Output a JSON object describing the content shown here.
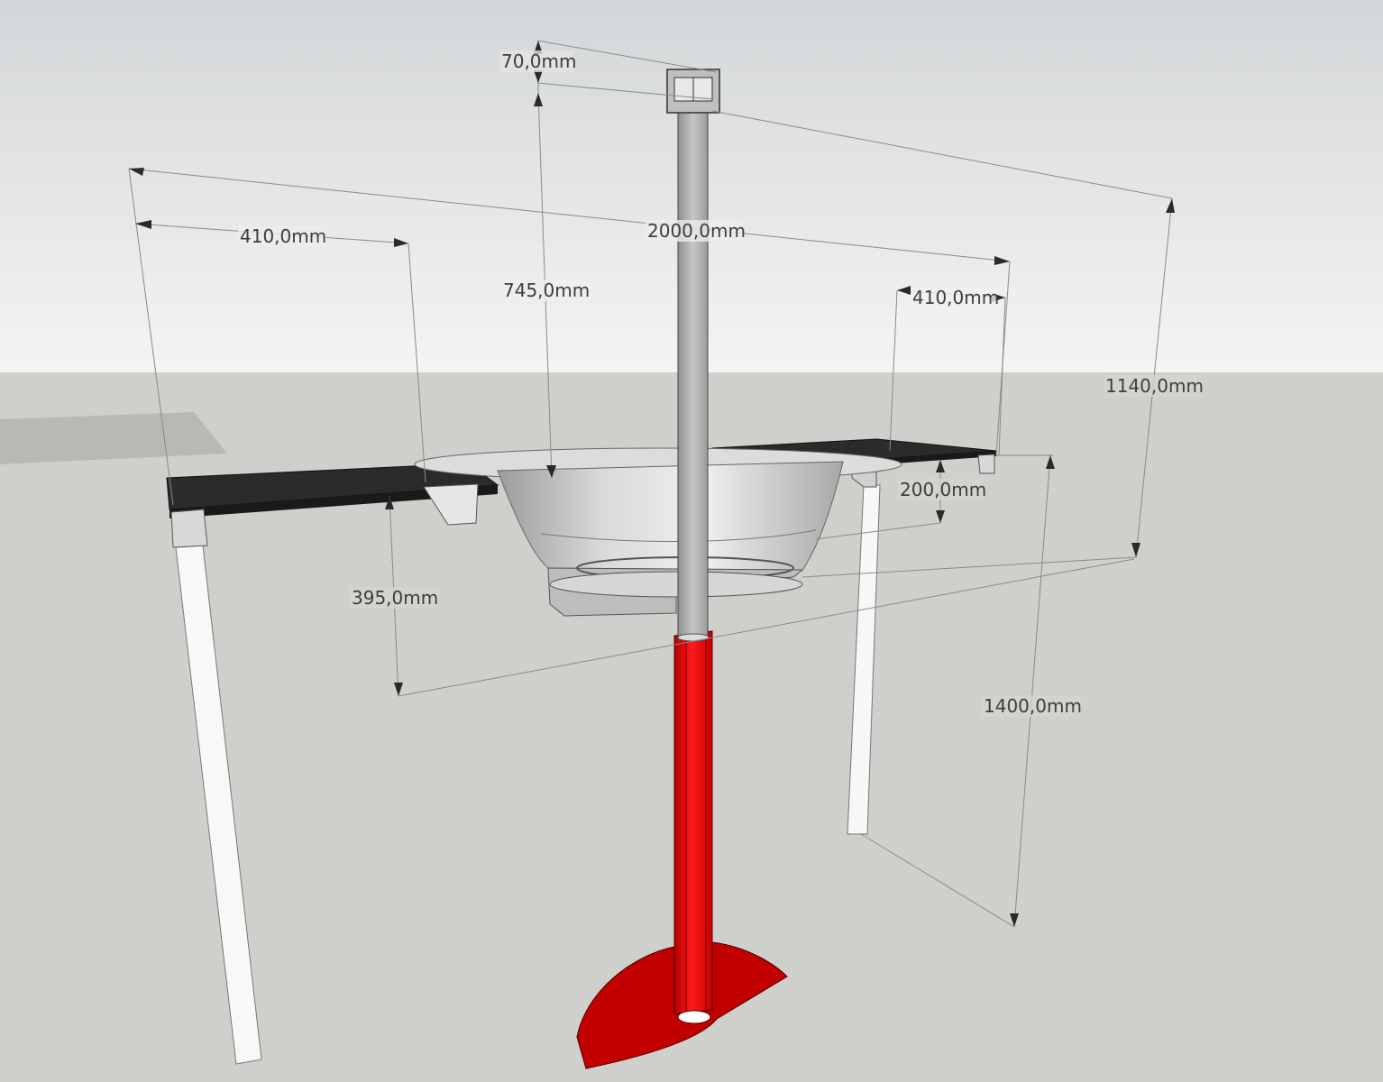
{
  "colors": {
    "sky_top": "#d6d9db",
    "sky_bottom": "#f2f2f2",
    "ground": "#cfcfcc",
    "tabletop": "#2e2e2e",
    "leg": "#f7f7f7",
    "pole_upper": "#a9a9a9",
    "pole_lower": "#f20d0d",
    "base": "#c00000",
    "bowl": "#c8c8c8"
  },
  "dimensions": {
    "d70": "70,0mm",
    "d745": "745,0mm",
    "d2000": "2000,0mm",
    "d410_left": "410,0mm",
    "d410_right": "410,0mm",
    "d1140": "1140,0mm",
    "d200": "200,0mm",
    "d395": "395,0mm",
    "d1400": "1400,0mm"
  }
}
